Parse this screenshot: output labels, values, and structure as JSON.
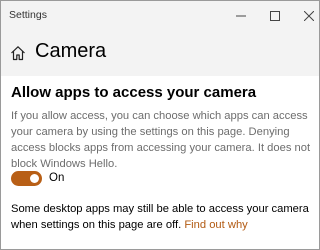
{
  "window": {
    "app_title": "Settings",
    "controls": {
      "minimize": "minimize",
      "maximize": "maximize",
      "close": "close"
    }
  },
  "header": {
    "icon": "home-icon",
    "title": "Camera"
  },
  "section": {
    "heading": "Allow apps to access your camera",
    "description": "If you allow access, you can choose which apps can access your camera by using the settings on this page. Denying access blocks apps from accessing your camera. It does not block Windows Hello.",
    "toggle": {
      "state": "on",
      "label": "On",
      "color": "#b85f16"
    },
    "note": "Some desktop apps may still be able to access your camera when settings on this page are off.",
    "link": "Find out why"
  },
  "colors": {
    "accent": "#b85f16",
    "link": "#b25a12",
    "header_bg": "#f3f3f3",
    "description_text": "#6d6d6d"
  }
}
